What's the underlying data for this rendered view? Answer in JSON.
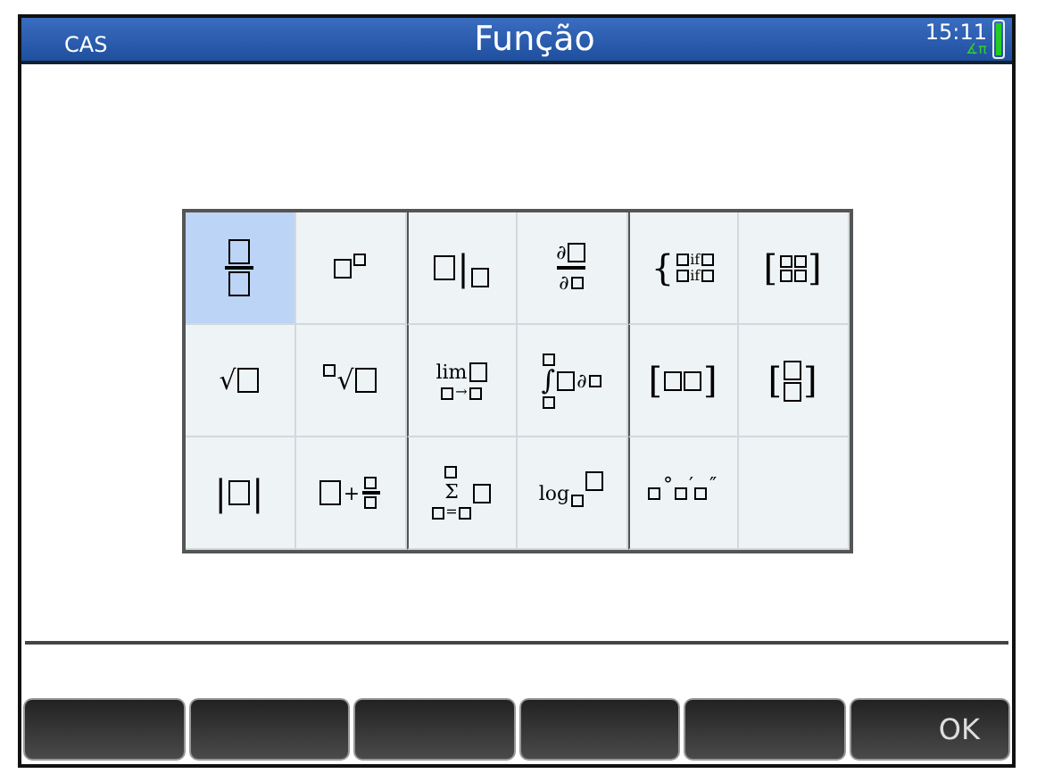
{
  "status_bar": {
    "mode": "CAS",
    "title": "Função",
    "time": "15:11",
    "angle_indicator": "∡π"
  },
  "templates": [
    {
      "kind": "fraction",
      "selected": true
    },
    {
      "kind": "power",
      "selected": false
    },
    {
      "kind": "evaluate",
      "selected": false,
      "text": [
        "|"
      ]
    },
    {
      "kind": "derivative",
      "selected": false,
      "text": [
        "∂",
        "∂"
      ]
    },
    {
      "kind": "piecewise",
      "selected": false,
      "text": [
        "{",
        "if",
        "if"
      ]
    },
    {
      "kind": "matrix",
      "selected": false,
      "text": [
        "[",
        "]"
      ]
    },
    {
      "kind": "sqrt",
      "selected": false,
      "text": [
        "√"
      ]
    },
    {
      "kind": "nthroot",
      "selected": false,
      "text": [
        "√"
      ]
    },
    {
      "kind": "limit",
      "selected": false,
      "text": [
        "lim",
        "→"
      ]
    },
    {
      "kind": "integral",
      "selected": false,
      "text": [
        "∫",
        "∂"
      ]
    },
    {
      "kind": "row_vector",
      "selected": false,
      "text": [
        "[",
        "]"
      ]
    },
    {
      "kind": "column_vector",
      "selected": false,
      "text": [
        "[",
        "]"
      ]
    },
    {
      "kind": "abs",
      "selected": false,
      "text": [
        "|",
        "|"
      ]
    },
    {
      "kind": "mixed_fraction",
      "selected": false,
      "text": [
        "+"
      ]
    },
    {
      "kind": "sum",
      "selected": false,
      "text": [
        "Σ",
        "="
      ]
    },
    {
      "kind": "log",
      "selected": false,
      "text": [
        "log"
      ]
    },
    {
      "kind": "dms",
      "selected": false,
      "text": [
        "°",
        "′",
        "″"
      ]
    }
  ],
  "softkeys": [
    {
      "kind": "empty"
    },
    {
      "kind": "empty"
    },
    {
      "kind": "empty"
    },
    {
      "kind": "empty"
    },
    {
      "kind": "empty"
    },
    {
      "kind": "labeled",
      "label": "OK"
    }
  ]
}
